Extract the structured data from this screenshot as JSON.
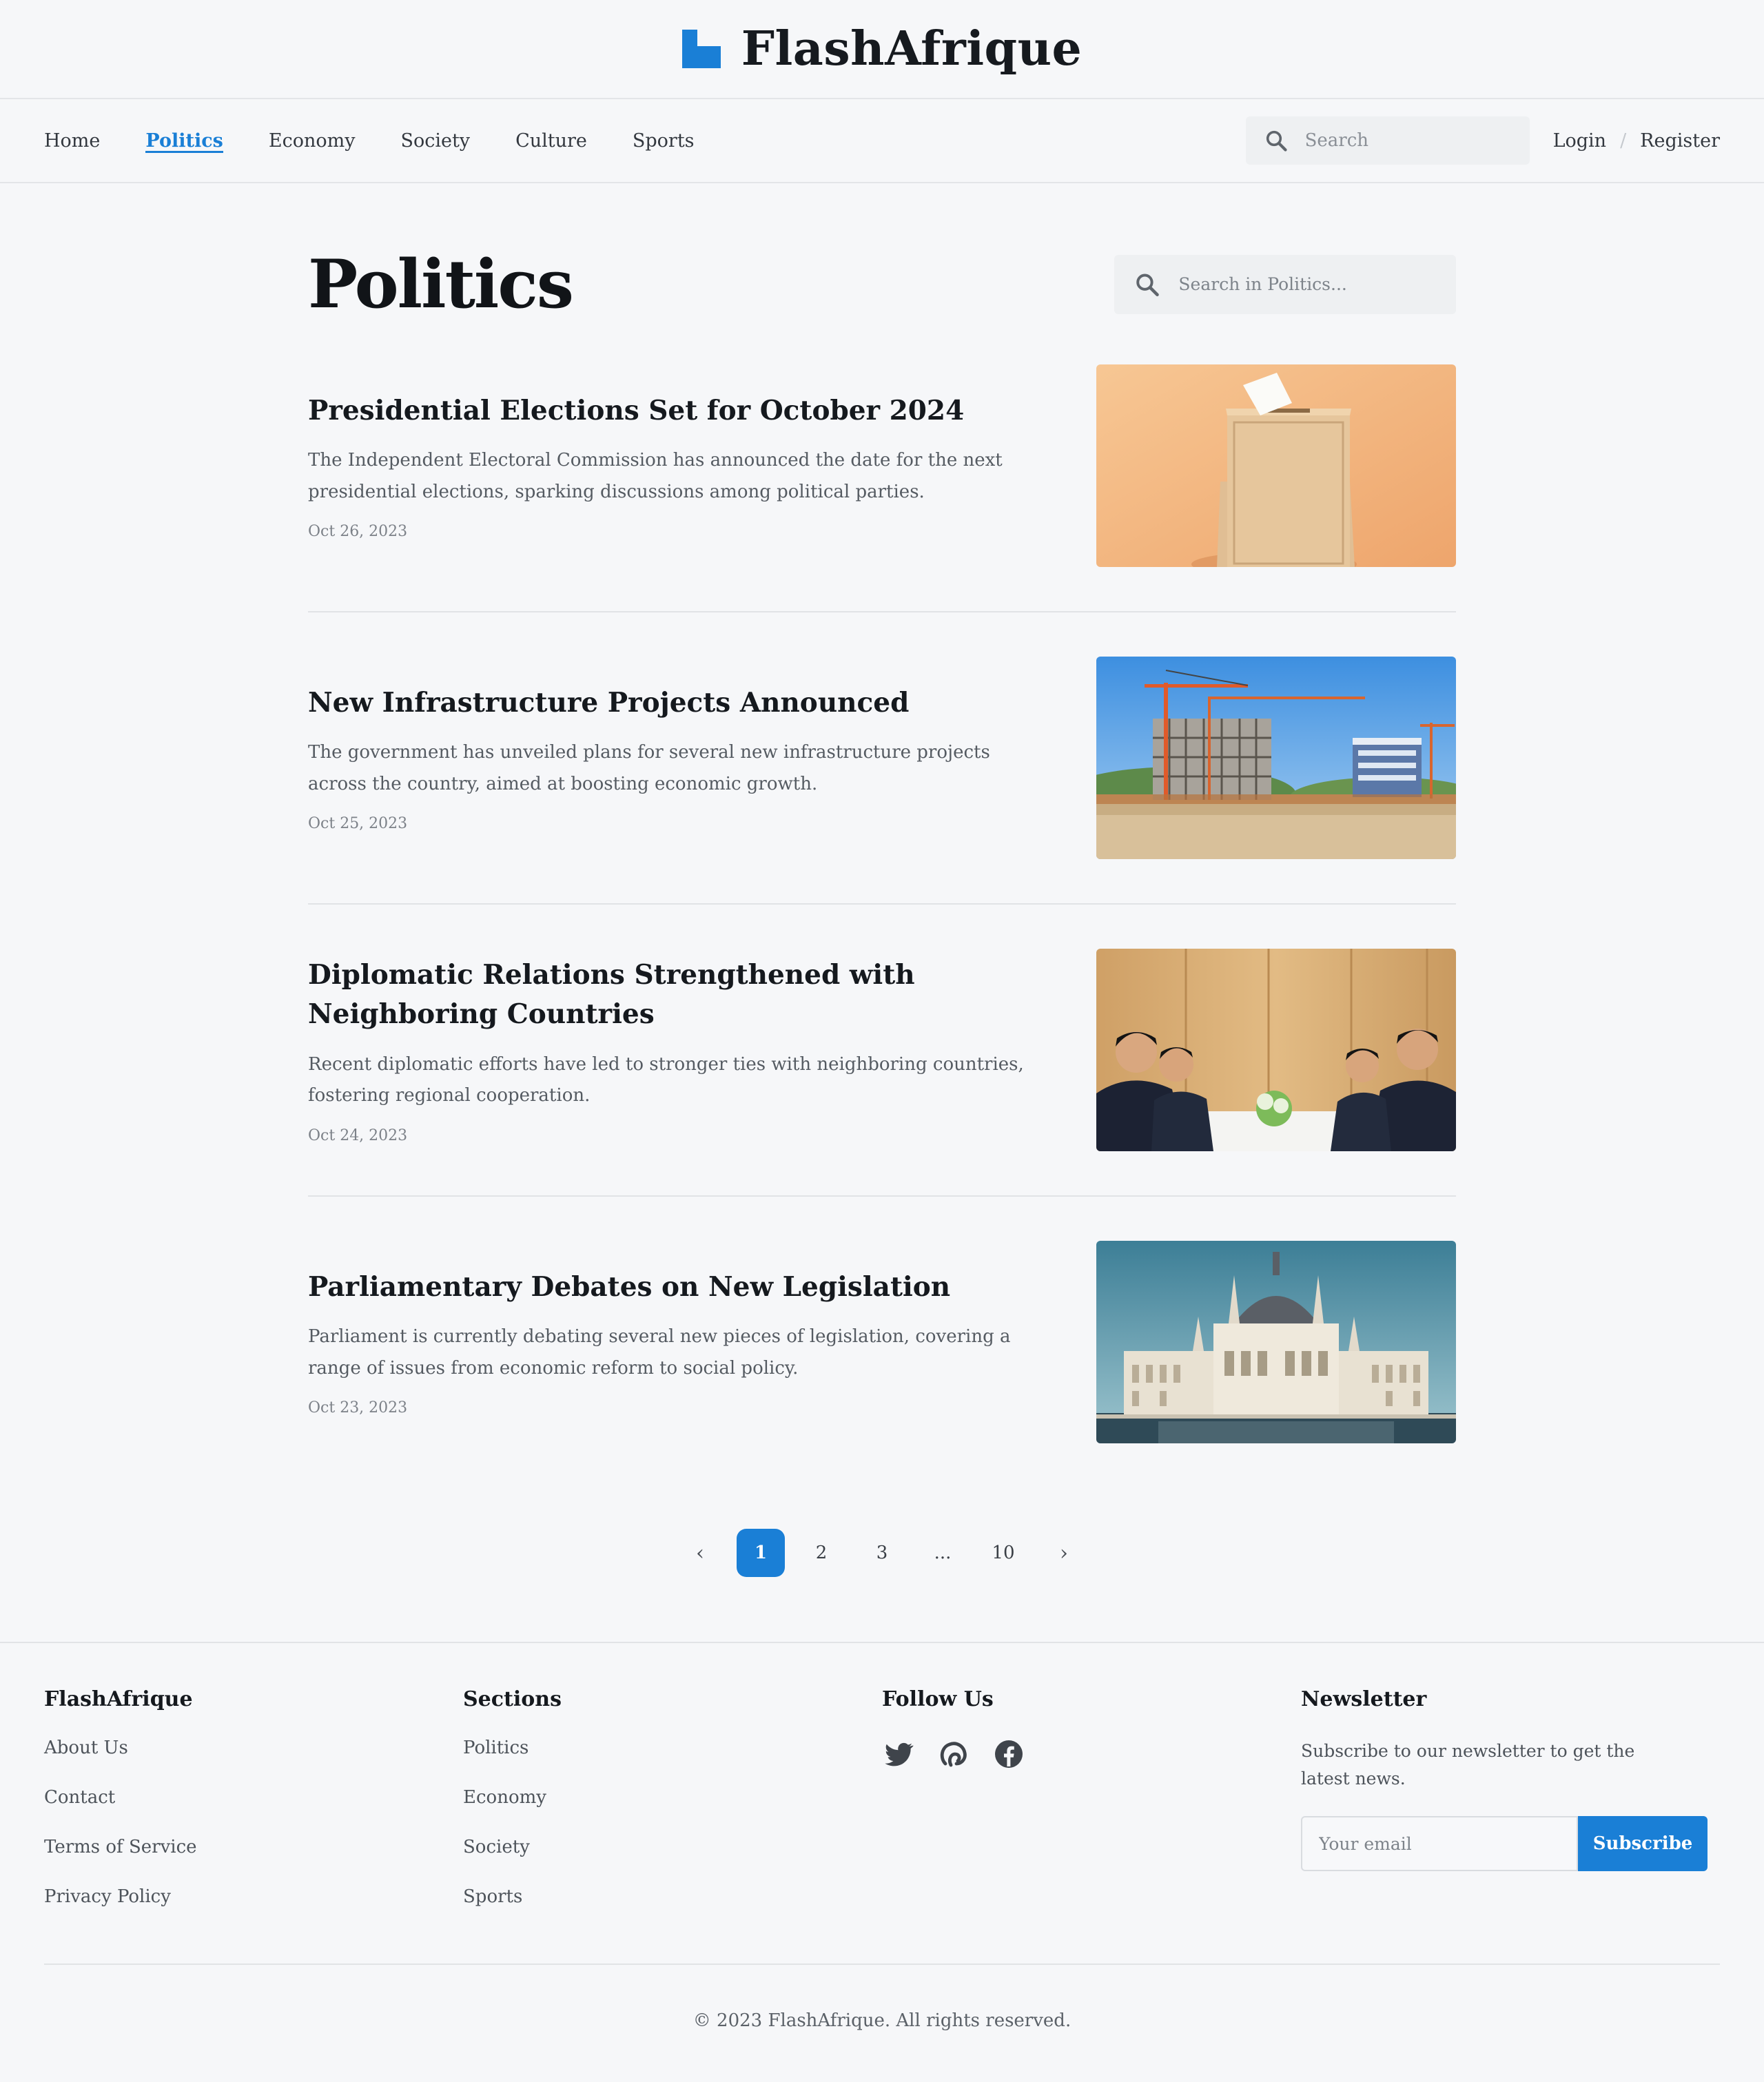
{
  "brand": {
    "name": "FlashAfrique"
  },
  "nav": {
    "items": [
      {
        "label": "Home",
        "active": false
      },
      {
        "label": "Politics",
        "active": true
      },
      {
        "label": "Economy",
        "active": false
      },
      {
        "label": "Society",
        "active": false
      },
      {
        "label": "Culture",
        "active": false
      },
      {
        "label": "Sports",
        "active": false
      }
    ],
    "search_placeholder": "Search",
    "login": "Login",
    "separator": "/",
    "register": "Register"
  },
  "page": {
    "title": "Politics",
    "search_placeholder": "Search in Politics..."
  },
  "articles": [
    {
      "title": "Presidential Elections Set for October 2024",
      "summary": "The Independent Electoral Commission has announced the date for the next presidential elections, sparking discussions among political parties.",
      "date": "Oct 26, 2023",
      "image": "ballot-box"
    },
    {
      "title": "New Infrastructure Projects Announced",
      "summary": "The government has unveiled plans for several new infrastructure projects across the country, aimed at boosting economic growth.",
      "date": "Oct 25, 2023",
      "image": "construction-site"
    },
    {
      "title": "Diplomatic Relations Strengthened with Neighboring Countries",
      "summary": "Recent diplomatic efforts have led to stronger ties with neighboring countries, fostering regional cooperation.",
      "date": "Oct 24, 2023",
      "image": "diplomatic-meeting"
    },
    {
      "title": "Parliamentary Debates on New Legislation",
      "summary": "Parliament is currently debating several new pieces of legislation, covering a range of issues from economic reform to social policy.",
      "date": "Oct 23, 2023",
      "image": "parliament-building"
    }
  ],
  "pagination": {
    "prev": "‹",
    "pages": [
      "1",
      "2",
      "3",
      "...",
      "10"
    ],
    "current": "1",
    "next": "›"
  },
  "footer": {
    "brand_heading": "FlashAfrique",
    "brand_links": [
      "About Us",
      "Contact",
      "Terms of Service",
      "Privacy Policy"
    ],
    "sections_heading": "Sections",
    "section_links": [
      "Politics",
      "Economy",
      "Society",
      "Sports"
    ],
    "follow_heading": "Follow Us",
    "socials": [
      "twitter-icon",
      "social-link-icon",
      "facebook-icon"
    ],
    "newsletter_heading": "Newsletter",
    "newsletter_text": "Subscribe to our newsletter to get the latest news.",
    "email_placeholder": "Your email",
    "subscribe_label": "Subscribe",
    "copyright": "© 2023 FlashAfrique. All rights reserved."
  },
  "colors": {
    "accent": "#1a7fd6",
    "background": "#f6f7f9"
  }
}
